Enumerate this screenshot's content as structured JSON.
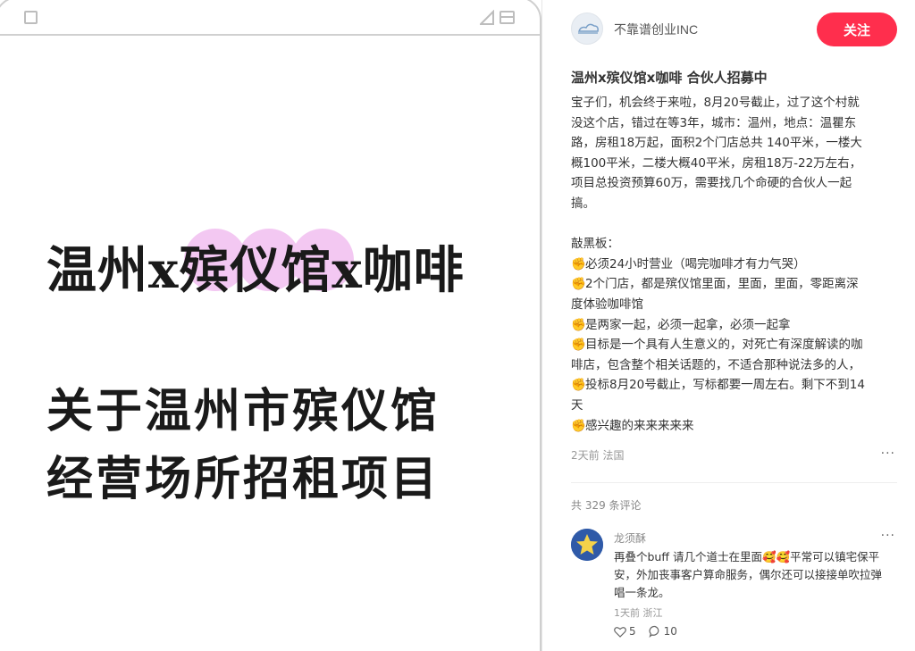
{
  "image_panel": {
    "headline_parts": [
      "温州x",
      "殡仪馆",
      "x咖啡"
    ],
    "subtitle_line1": "关于温州市殡仪馆",
    "subtitle_line2": "经营场所招租项目",
    "highlight_color": "#f3c8f2"
  },
  "author": {
    "name": "不靠谱创业INC",
    "follow_label": "关注"
  },
  "note": {
    "title": "温州x殡仪馆x咖啡 合伙人招募中",
    "body_lines": [
      "宝子们，机会终于来啦，8月20号截止，过了这个村就",
      "没这个店，错过在等3年，城市：温州，地点：温瞿东",
      "路，房租18万起，面积2个门店总共 140平米，一楼大",
      "概100平米，二楼大概40平米，房租18万-22万左右，",
      "项目总投资预算60万，需要找几个命硬的合伙人一起",
      "搞。"
    ],
    "blackboard_title": "敲黑板：",
    "bullets": [
      "必须24小时营业（喝完咖啡才有力气哭）",
      "2个门店，都是殡仪馆里面，里面，里面，零距离深",
      "度体验咖啡馆",
      "是两家一起，必须一起拿，必须一起拿",
      "目标是一个具有人生意义的，对死亡有深度解读的咖",
      "啡店，包含整个相关话题的，不适合那种说法多的人，",
      "投标8月20号截止，写标都要一周左右。剩下不到14",
      "天",
      "感兴趣的来来来来来"
    ],
    "meta": "2天前 法国",
    "more": "···",
    "comment_count": "共 329 条评论"
  },
  "comment": {
    "name": "龙须酥",
    "text_line1": "再叠个buff 请几个道士在里面🥰🥰平常可以镇宅保平",
    "text_line2": "安，外加丧事客户算命服务，偶尔还可以接接单吹拉弹",
    "text_line3": "唱一条龙。",
    "meta": "1天前 浙江",
    "likes": "5",
    "replies": "10",
    "more": "···"
  }
}
